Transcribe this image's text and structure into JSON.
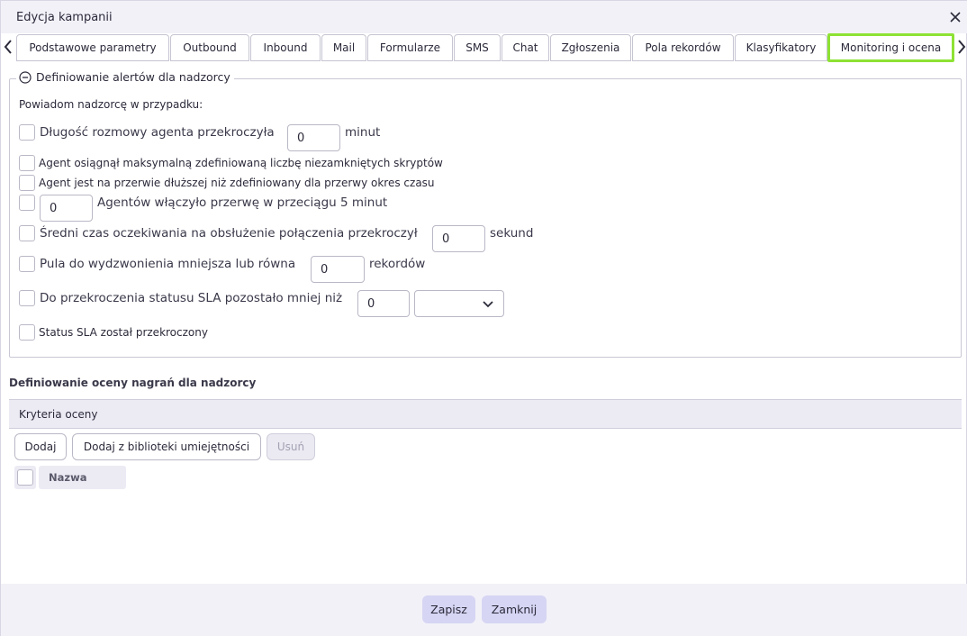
{
  "window": {
    "title": "Edycja kampanii"
  },
  "tabs": [
    {
      "label": "Podstawowe parametry"
    },
    {
      "label": "Outbound"
    },
    {
      "label": "Inbound"
    },
    {
      "label": "Mail"
    },
    {
      "label": "Formularze"
    },
    {
      "label": "SMS"
    },
    {
      "label": "Chat"
    },
    {
      "label": "Zgłoszenia"
    },
    {
      "label": "Pola rekordów"
    },
    {
      "label": "Klasyfikatory"
    },
    {
      "label": "Monitoring i ocena",
      "active": true
    }
  ],
  "alerts": {
    "legend": "Definiowanie alertów dla nadzorcy",
    "intro": "Powiadom nadzorcę w przypadku:",
    "rows": {
      "call_length": {
        "label": "Długość rozmowy agenta przekroczyła",
        "value": "0",
        "unit": "minut",
        "checked": false
      },
      "scripts": {
        "label": "Agent osiągnął maksymalną zdefiniowaną liczbę niezamkniętych skryptów",
        "checked": false
      },
      "break_time": {
        "label": "Agent jest na przerwie dłuższej niż zdefiniowany dla przerwy okres czasu",
        "checked": false
      },
      "agents_break": {
        "value": "0",
        "label": "Agentów włączyło przerwę w przeciągu 5 minut",
        "checked": false
      },
      "avg_wait": {
        "label": "Średni czas oczekiwania na obsłużenie połączenia przekroczył",
        "value": "0",
        "unit": "sekund",
        "checked": false
      },
      "pool": {
        "label": "Pula do wydzwonienia mniejsza lub równa",
        "value": "0",
        "unit": "rekordów",
        "checked": false
      },
      "sla_left": {
        "label": "Do przekroczenia statusu SLA pozostało mniej niż",
        "value": "0",
        "select_value": "",
        "checked": false
      },
      "sla_exceeded": {
        "label": "Status SLA został przekroczony",
        "checked": false
      }
    }
  },
  "rating": {
    "title": "Definiowanie oceny nagrań dla nadzorcy",
    "criteria_header": "Kryteria oceny",
    "buttons": {
      "add": "Dodaj",
      "add_library": "Dodaj z biblioteki umiejętności",
      "remove": "Usuń"
    },
    "grid_column": "Nazwa"
  },
  "footer": {
    "save": "Zapisz",
    "close": "Zamknij"
  },
  "colors": {
    "active_tab_border": "#8ee234",
    "footer_button": "#d6d5f3",
    "header_bg": "#ecebf4"
  }
}
